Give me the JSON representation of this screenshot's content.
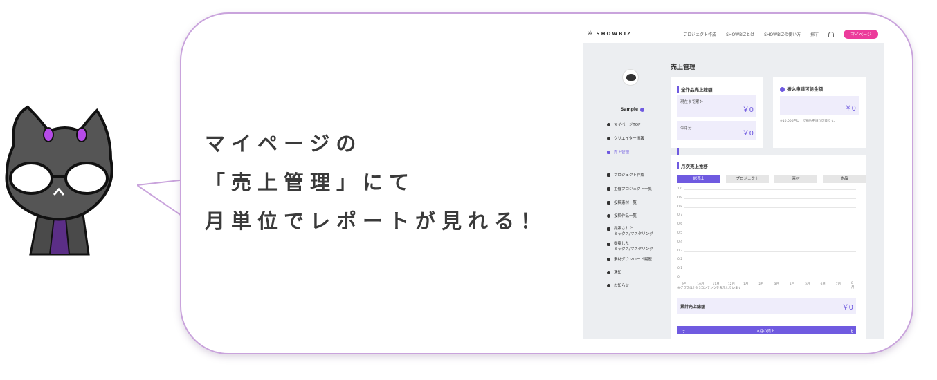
{
  "headline": {
    "line1": "マイページの",
    "line2": "「売上管理」にて",
    "line3": "月単位でレポートが見れる！"
  },
  "app": {
    "logo": "SHOWBIZ",
    "nav": {
      "project_create": "プロジェクト作成",
      "about": "SHOWBIZとは",
      "howto": "SHOWBIZの使い方",
      "search": "探す",
      "mypage": "マイページ"
    },
    "user": {
      "name": "Sample"
    },
    "sidebar": {
      "items": [
        {
          "label": "マイページTOP",
          "icon": "user-icon"
        },
        {
          "label": "クリエイター情報",
          "icon": "gear-icon"
        },
        {
          "label": "売上管理",
          "icon": "wallet-icon"
        },
        {
          "label": "プロジェクト作成",
          "icon": "music-icon"
        },
        {
          "label": "主催プロジェクト一覧",
          "icon": "flag-icon"
        },
        {
          "label": "投稿素材一覧",
          "icon": "file-icon"
        },
        {
          "label": "投稿作品一覧",
          "icon": "disc-icon"
        },
        {
          "label": "提案された",
          "label2": "ミックス/マスタリング",
          "icon": "doc-icon"
        },
        {
          "label": "提案した",
          "label2": "ミックス/マスタリング",
          "icon": "doc-icon"
        },
        {
          "label": "素材ダウンロード履歴",
          "icon": "download-icon"
        },
        {
          "label": "通知",
          "icon": "bell-icon"
        },
        {
          "label": "お知らせ",
          "icon": "info-icon"
        }
      ]
    },
    "page_title": "売上管理",
    "total_sales": {
      "title": "全作品売上総額",
      "cumulative_label": "現在まで累計",
      "cumulative_value": "￥0",
      "month_label": "今月分",
      "month_value": "￥0"
    },
    "withdraw": {
      "title": "振込申請可能金額",
      "value": "￥0",
      "note": "※10,000円以上で振込申請が可能です。"
    },
    "monthly": {
      "title": "月次売上推移",
      "tabs": [
        "総売上",
        "プロジェクト",
        "素材",
        "作品"
      ],
      "note": "※グラフは上位3コンテンツを表示しています",
      "total_label": "累計売上総額",
      "total_value": "￥0",
      "month_prev": "7月",
      "month_current": "8月の売上",
      "month_next": "9月"
    }
  },
  "chart_data": {
    "type": "line",
    "x": [
      "9月",
      "10月",
      "11月",
      "12月",
      "1月",
      "2月",
      "3月",
      "4月",
      "5月",
      "6月",
      "7月",
      "8月"
    ],
    "series": [],
    "yticks": [
      "1.0",
      "0.9",
      "0.8",
      "0.7",
      "0.6",
      "0.5",
      "0.4",
      "0.3",
      "0.2",
      "0.1",
      "0"
    ],
    "ylim": [
      0,
      1.0
    ],
    "grid": true
  },
  "colors": {
    "accent": "#6f5ae0",
    "pink": "#ec3b9b",
    "bubble_border": "#c9a3dc"
  }
}
